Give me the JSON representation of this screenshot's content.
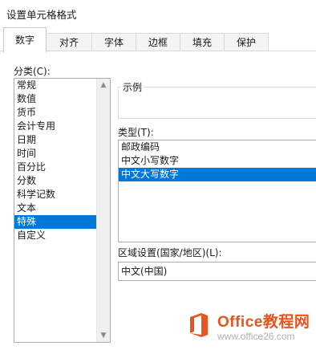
{
  "window": {
    "title": "设置单元格格式"
  },
  "tabs": [
    "数字",
    "对齐",
    "字体",
    "边框",
    "填充",
    "保护"
  ],
  "active_tab": "数字",
  "category": {
    "label": "分类(C):",
    "items": [
      "常规",
      "数值",
      "货币",
      "会计专用",
      "日期",
      "时间",
      "百分比",
      "分数",
      "科学记数",
      "文本",
      "特殊",
      "自定义"
    ],
    "selected": "特殊"
  },
  "sample": {
    "label": "示例",
    "value": ""
  },
  "type": {
    "label": "类型(T):",
    "items": [
      "邮政编码",
      "中文小写数字",
      "中文大写数字"
    ],
    "selected": "中文大写数字"
  },
  "locale": {
    "label": "区域设置(国家/地区)(L):",
    "value": "中文(中国)"
  },
  "watermark": {
    "brand": "Office教程网",
    "url": "www.office26.com"
  },
  "colors": {
    "selection": "#0078d7",
    "brand": "#e8531f"
  }
}
